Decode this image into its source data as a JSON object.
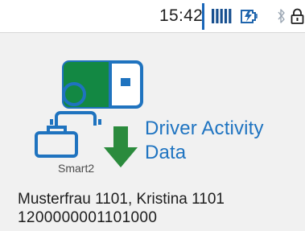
{
  "status_bar": {
    "time": "15:42",
    "icons": [
      "signal-bars-icon",
      "charging-battery-icon",
      "bluetooth-icon",
      "lock-icon"
    ]
  },
  "illustration": {
    "card_label": "Smart2",
    "title": "Driver Activity Data",
    "icons": [
      "driver-card-icon",
      "briefcase-icon",
      "download-arrow-icon"
    ]
  },
  "driver": {
    "name": "Musterfrau 1101, Kristina 1101",
    "card_number": "1200000001101000"
  },
  "colors": {
    "accent_blue": "#1f74c1",
    "status_blue": "#1a66b8",
    "download_green": "#2b8b3d",
    "card_green": "#138843",
    "background": "#f1f1f1"
  }
}
